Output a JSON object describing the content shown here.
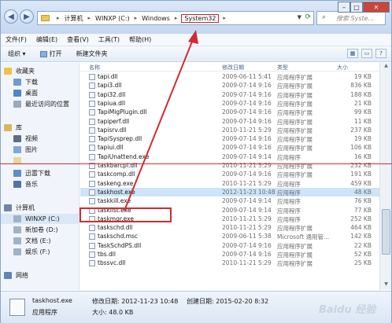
{
  "address": {
    "crumbs": [
      "计算机",
      "WINXP (C:)",
      "Windows",
      "System32"
    ],
    "search_placeholder": "搜索 Syste..."
  },
  "window_controls": {
    "minimize": "–",
    "maximize": "□",
    "close": "✕"
  },
  "menu": [
    "文件(F)",
    "编辑(E)",
    "查看(V)",
    "工具(T)",
    "帮助(H)"
  ],
  "toolbar": {
    "organize": "组织 ▾",
    "open": "打开",
    "new_folder": "新建文件夹"
  },
  "nav": {
    "favorites": "收藏夹",
    "downloads": "下载",
    "desktop": "桌面",
    "recent": "最近访问的位置",
    "libraries": "库",
    "videos": "视频",
    "pictures": "图片",
    "xunlei": "迅雷下载",
    "music": "音乐",
    "computer": "计算机",
    "c_drive": "WINXP (C:)",
    "d_drive": "新加卷 (D:)",
    "e_drive": "文档 (E:)",
    "f_drive": "娱乐 (F:)",
    "network": "网络"
  },
  "columns": {
    "name": "名称",
    "date": "修改日期",
    "type": "类型",
    "size": "大小"
  },
  "files": [
    {
      "name": "tapi.dll",
      "date": "2009-06-11 5:41",
      "type": "应用程序扩展",
      "size": "19 KB"
    },
    {
      "name": "tapi3.dll",
      "date": "2009-07-14 9:16",
      "type": "应用程序扩展",
      "size": "836 KB"
    },
    {
      "name": "tapi32.dll",
      "date": "2009-07-14 9:16",
      "type": "应用程序扩展",
      "size": "188 KB"
    },
    {
      "name": "tapiua.dll",
      "date": "2009-07-14 9:16",
      "type": "应用程序扩展",
      "size": "21 KB"
    },
    {
      "name": "TapiMigPlugin.dll",
      "date": "2009-07-14 9:16",
      "type": "应用程序扩展",
      "size": "99 KB"
    },
    {
      "name": "tapiperf.dll",
      "date": "2009-07-14 9:16",
      "type": "应用程序扩展",
      "size": "11 KB"
    },
    {
      "name": "tapisrv.dll",
      "date": "2010-11-21 5:29",
      "type": "应用程序扩展",
      "size": "237 KB"
    },
    {
      "name": "TapiSysprep.dll",
      "date": "2009-07-14 9:16",
      "type": "应用程序扩展",
      "size": "19 KB"
    },
    {
      "name": "tapiui.dll",
      "date": "2009-07-14 9:16",
      "type": "应用程序扩展",
      "size": "106 KB"
    },
    {
      "name": "TapiUnattend.exe",
      "date": "2009-07-14 9:14",
      "type": "应用程序",
      "size": "16 KB"
    },
    {
      "name": "taskbarcpl.dll",
      "date": "2010-11-21 5:29",
      "type": "应用程序扩展",
      "size": "232 KB"
    },
    {
      "name": "taskcomp.dll",
      "date": "2009-07-14 9:16",
      "type": "应用程序扩展",
      "size": "191 KB"
    },
    {
      "name": "taskeng.exe",
      "date": "2010-11-21 5:29",
      "type": "应用程序",
      "size": "459 KB"
    },
    {
      "name": "taskhost.exe",
      "date": "2012-11-23 10:48",
      "type": "应用程序",
      "size": "48 KB"
    },
    {
      "name": "taskkill.exe",
      "date": "2009-07-14 9:14",
      "type": "应用程序",
      "size": "76 KB"
    },
    {
      "name": "tasklist.exe",
      "date": "2009-07-14 9:14",
      "type": "应用程序",
      "size": "77 KB"
    },
    {
      "name": "taskmgr.exe",
      "date": "2010-11-21 5:29",
      "type": "应用程序",
      "size": "252 KB"
    },
    {
      "name": "taskschd.dll",
      "date": "2010-11-21 5:29",
      "type": "应用程序扩展",
      "size": "464 KB"
    },
    {
      "name": "taskschd.msc",
      "date": "2009-06-11 5:38",
      "type": "Microsoft 通用管...",
      "size": "142 KB"
    },
    {
      "name": "TaskSchdPS.dll",
      "date": "2009-07-14 9:16",
      "type": "应用程序扩展",
      "size": "22 KB"
    },
    {
      "name": "tbs.dll",
      "date": "2009-07-14 9:16",
      "type": "应用程序扩展",
      "size": "52 KB"
    },
    {
      "name": "tbssvc.dll",
      "date": "2010-11-21 5:29",
      "type": "应用程序扩展",
      "size": "25 KB"
    }
  ],
  "status": {
    "filename": "taskhost.exe",
    "modified": "修改日期: 2012-11-23 10:48",
    "created": "创建日期: 2015-02-20 8:32",
    "type": "应用程序",
    "size": "大小: 48.0 KB"
  },
  "watermark": "Baidu 经验",
  "colors": {
    "selection": "#cde4f9",
    "annotation": "#d42b30",
    "title_bar": "#c4d8f0"
  }
}
